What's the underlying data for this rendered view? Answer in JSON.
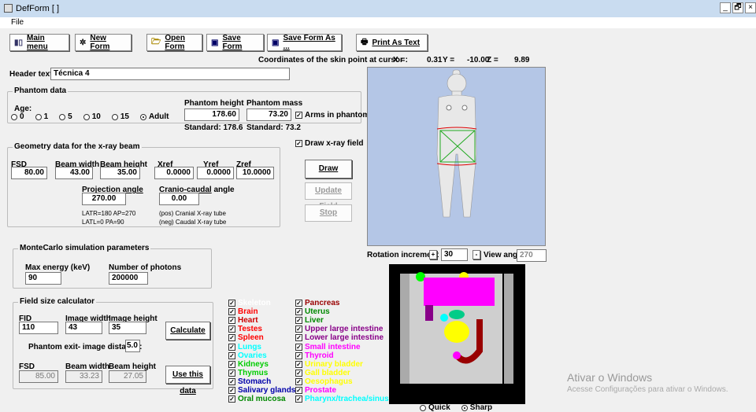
{
  "window": {
    "title": "DefForm [ ]",
    "controls": [
      "_",
      "🗗",
      "×"
    ]
  },
  "menu": {
    "file": "File"
  },
  "toolbar": {
    "main_menu": "Main menu",
    "new_form": "New Form",
    "open_form": "Open Form",
    "save_form": "Save Form",
    "save_form_as": "Save Form As ...",
    "print_as_text": "Print As Text"
  },
  "coords": {
    "label": "Coordinates of the skin point at cursor :",
    "x_label": "X =",
    "x": "0.31",
    "y_label": "Y =",
    "y": "-10.00",
    "z_label": "Z =",
    "z": "9.89"
  },
  "header": {
    "label": "Header text",
    "value": "Técnica 4"
  },
  "phantom": {
    "title": "Phantom data",
    "age_label": "Age:",
    "ages": [
      {
        "label": "0",
        "selected": false
      },
      {
        "label": "1",
        "selected": false
      },
      {
        "label": "5",
        "selected": false
      },
      {
        "label": "10",
        "selected": false
      },
      {
        "label": "15",
        "selected": false
      },
      {
        "label": "Adult",
        "selected": true
      }
    ],
    "height_label": "Phantom height",
    "height": "178.60",
    "height_std": "Standard: 178.6",
    "mass_label": "Phantom mass",
    "mass": "73.20",
    "mass_std": "Standard: 73.2",
    "arms_label": "Arms in phantom",
    "arms_checked": true
  },
  "draw_field": {
    "label": "Draw x-ray field",
    "checked": true
  },
  "geometry": {
    "title": "Geometry data for the x-ray beam",
    "fsd_label": "FSD",
    "fsd": "80.00",
    "bw_label": "Beam width",
    "bw": "43.00",
    "bh_label": "Beam height",
    "bh": "35.00",
    "xref_label": "Xref",
    "xref": "0.0000",
    "yref_label": "Yref",
    "yref": "0.0000",
    "zref_label": "Zref",
    "zref": "10.0000",
    "proj_label": "Projection angle",
    "proj": "270.00",
    "cranio_label": "Cranio-caudal",
    "cranio_label2": "angle",
    "cranio": "0.00",
    "latr": "LATR=180  AP=270",
    "latl": "LATL=0    PA=90",
    "pos": "(pos) Cranial X-ray tube",
    "neg": "(neg) Caudal X-ray tube"
  },
  "buttons": {
    "draw": "Draw",
    "update": "Update Field",
    "stop": "Stop",
    "calculate": "Calculate",
    "use": "Use this data"
  },
  "montecarlo": {
    "title": "MonteCarlo simulation parameters",
    "energy_label": "Max energy (keV)",
    "energy": "90",
    "photons_label": "Number of photons",
    "photons": "200000"
  },
  "fieldcalc": {
    "title": "Field size calculator",
    "fid_label": "FID",
    "fid": "110",
    "iw_label": "Image width",
    "iw": "43",
    "ih_label": "Image height",
    "ih": "35",
    "exit_label": "Phantom exit- image distance:",
    "exit": "5.0",
    "fsd_label": "FSD",
    "fsd": "85.00",
    "bw_label": "Beam width",
    "bw": "33.23",
    "bh_label": "Beam height",
    "bh": "27.05"
  },
  "rotation": {
    "label": "Rotation increment",
    "value": "30",
    "view_label": "View angle",
    "view": "270"
  },
  "organs_left": [
    {
      "name": "Skeleton",
      "color": "#ffffff"
    },
    {
      "name": "Brain",
      "color": "#ff0000"
    },
    {
      "name": "Heart",
      "color": "#cc0000"
    },
    {
      "name": "Testes",
      "color": "#ff0000"
    },
    {
      "name": "Spleen",
      "color": "#ff0000"
    },
    {
      "name": "Lungs",
      "color": "#00ffff"
    },
    {
      "name": "Ovaries",
      "color": "#00ffff"
    },
    {
      "name": "Kidneys",
      "color": "#00cc00"
    },
    {
      "name": "Thymus",
      "color": "#00cc00"
    },
    {
      "name": "Stomach",
      "color": "#0000aa"
    },
    {
      "name": "Salivary glands",
      "color": "#0000aa"
    },
    {
      "name": "Oral mucosa",
      "color": "#008800"
    }
  ],
  "organs_right": [
    {
      "name": "Pancreas",
      "color": "#990000"
    },
    {
      "name": "Uterus",
      "color": "#008800"
    },
    {
      "name": "Liver",
      "color": "#008800"
    },
    {
      "name": "Upper large intestine",
      "color": "#880088"
    },
    {
      "name": "Lower large intestine",
      "color": "#880088"
    },
    {
      "name": "Small intestine",
      "color": "#ff00ff"
    },
    {
      "name": "Thyroid",
      "color": "#ff00ff"
    },
    {
      "name": "Urinary bladder",
      "color": "#ffff00"
    },
    {
      "name": "Gall bladder",
      "color": "#ffff00"
    },
    {
      "name": "Oesophagus",
      "color": "#ffff00"
    },
    {
      "name": "Prostate",
      "color": "#ff00ff"
    },
    {
      "name": "Pharynx/trachea/sinus",
      "color": "#00ffff"
    }
  ],
  "render_mode": {
    "quick": "Quick",
    "sharp": "Sharp",
    "selected": "sharp"
  },
  "watermark": {
    "line1": "Ativar o Windows",
    "line2": "Acesse Configurações para ativar o Windows."
  }
}
